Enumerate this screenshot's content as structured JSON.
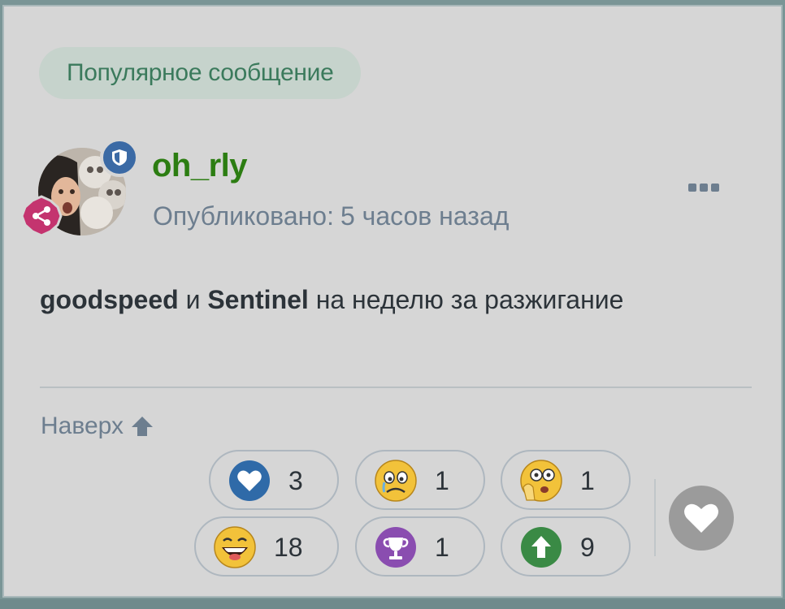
{
  "badge": {
    "label": "Популярное сообщение"
  },
  "post": {
    "author": "oh_rly",
    "posted_label": "Опубликовано:",
    "posted_time": "5 часов назад",
    "message": {
      "mention1": "goodspeed",
      "and": "и",
      "mention2": "Sentinel",
      "rest": "на неделю за разжигание"
    }
  },
  "footer": {
    "to_top_label": "Наверх"
  },
  "reactions": [
    {
      "icon": "heart-reaction-icon",
      "count": "3"
    },
    {
      "icon": "crying-face-icon",
      "count": "1"
    },
    {
      "icon": "shocked-face-icon",
      "count": "1"
    },
    {
      "icon": "laughing-face-icon",
      "count": "18"
    },
    {
      "icon": "trophy-icon",
      "count": "1"
    },
    {
      "icon": "upvote-arrow-icon",
      "count": "9"
    }
  ],
  "colors": {
    "card_bg": "#d6d6d6",
    "badge_text": "#3b7a5c",
    "username": "#2c7d12",
    "muted_text": "#6d7e8f",
    "heart_blue": "#2f6aa8",
    "trophy_purple": "#8a4db0",
    "arrow_green": "#3a8a45"
  }
}
